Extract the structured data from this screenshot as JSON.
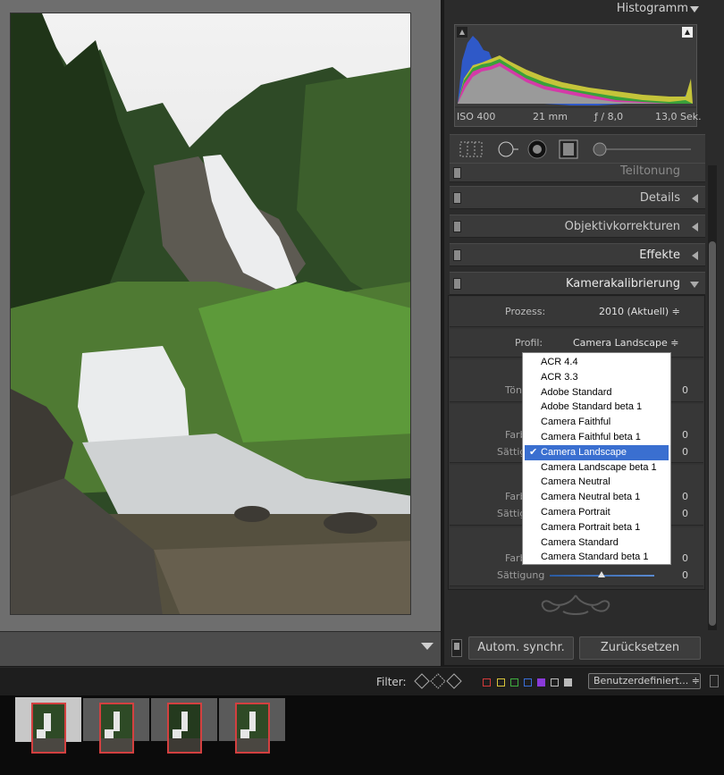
{
  "histogram": {
    "title": "Histogramm",
    "iso": "ISO 400",
    "focal": "21 mm",
    "aperture": "ƒ / 8,0",
    "shutter": "13,0 Sek."
  },
  "panels": [
    {
      "label": "Teiltonung"
    },
    {
      "label": "Details"
    },
    {
      "label": "Objektivkorrekturen"
    },
    {
      "label": "Effekte"
    },
    {
      "label": "Kamerakalibrierung"
    }
  ],
  "calibration": {
    "process_label": "Prozess:",
    "process_value": "2010 (Aktuell) ≑",
    "profile_label": "Profil:",
    "profile_value": "Camera Landscape ≑",
    "rows": [
      {
        "label": "Tönung",
        "value": "0"
      },
      {
        "label": "Farbton",
        "value": "0"
      },
      {
        "label": "Sättigung",
        "value": "0"
      },
      {
        "label": "Farbton",
        "value": "0"
      },
      {
        "label": "Sättigung",
        "value": "0"
      },
      {
        "label": "Farbton",
        "value": "0"
      },
      {
        "label": "Sättigung",
        "value": "0"
      }
    ]
  },
  "profile_options": [
    "ACR 4.4",
    "ACR 3.3",
    "Adobe Standard",
    "Adobe Standard beta 1",
    "Camera Faithful",
    "Camera Faithful beta 1",
    "Camera Landscape",
    "Camera Landscape beta 1",
    "Camera Neutral",
    "Camera Neutral beta 1",
    "Camera Portrait",
    "Camera Portrait beta 1",
    "Camera Standard",
    "Camera Standard beta 1"
  ],
  "selected_profile": "Camera Landscape",
  "buttons": {
    "sync": "Autom. synchr.",
    "reset": "Zurücksetzen"
  },
  "filterbar": {
    "label": "Filter:",
    "preset": "Benutzerdefiniert... ≑",
    "color_labels": [
      "#d43a3a",
      "#d9c43a",
      "#3fae3f",
      "#3a6fd9",
      "#8a3ad9",
      "#e0e0e0",
      "#e0e0e0"
    ]
  },
  "icons": {
    "collapse": "triangle-down-icon",
    "panel_toggle": "disclosure-triangle-icon",
    "ornament": "panel-end-ornament-icon"
  }
}
